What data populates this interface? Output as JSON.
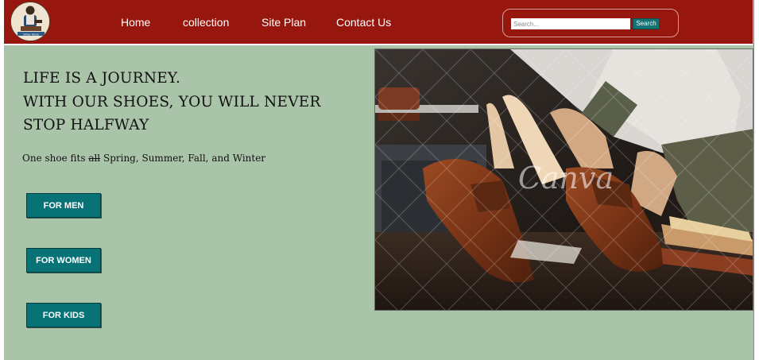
{
  "header": {
    "logo_text": "Shoe Store",
    "nav": [
      "Home",
      "collection",
      "Site Plan",
      "Contact Us"
    ],
    "search": {
      "placeholder": "Search...",
      "button_label": "Search"
    }
  },
  "hero": {
    "headline": [
      "LIFE IS A JOURNEY.",
      "WITH OUR SHOES, YOU WILL NEVER",
      "STOP HALFWAY"
    ],
    "tagline_prefix": "One shoe fits ",
    "tagline_strike": "all",
    "tagline_suffix": " Spring, Summer, Fall, and Winter",
    "watermark": "Canva"
  },
  "cta": [
    "FOR MEN",
    "FOR WOMEN",
    "FOR KIDS"
  ],
  "colors": {
    "header_bg": "#97170e",
    "page_bg": "#aac4aa",
    "button_bg": "#087377"
  }
}
